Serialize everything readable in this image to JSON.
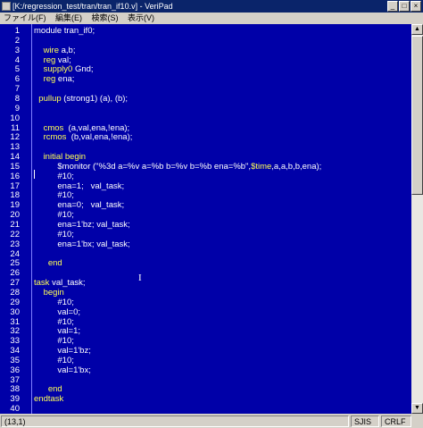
{
  "window": {
    "title": "[K:/regression_test/tran/tran_if10.v] - VeriPad",
    "buttons": {
      "minimize": "_",
      "maximize": "□",
      "close": "×"
    }
  },
  "menu": [
    "ファイル(F)",
    "編集(E)",
    "検索(S)",
    "表示(V)"
  ],
  "editor": {
    "line_numbers": [
      "1",
      "2",
      "3",
      "4",
      "5",
      "6",
      "7",
      "8",
      "9",
      "10",
      "11",
      "12",
      "13",
      "14",
      "15",
      "16",
      "17",
      "18",
      "19",
      "20",
      "21",
      "22",
      "23",
      "24",
      "25",
      "26",
      "27",
      "28",
      "29",
      "30",
      "31",
      "32",
      "33",
      "34",
      "35",
      "36",
      "37",
      "38",
      "39",
      "40"
    ],
    "lines": [
      [
        {
          "t": "module tran_if0;",
          "c": ""
        }
      ],
      [
        {
          "t": "",
          "c": ""
        }
      ],
      [
        {
          "t": "    ",
          "c": ""
        },
        {
          "t": "wire",
          "c": "kw"
        },
        {
          "t": " a,b;",
          "c": ""
        }
      ],
      [
        {
          "t": "    ",
          "c": ""
        },
        {
          "t": "reg",
          "c": "kw"
        },
        {
          "t": " val;",
          "c": ""
        }
      ],
      [
        {
          "t": "    ",
          "c": ""
        },
        {
          "t": "supply0",
          "c": "kw"
        },
        {
          "t": " Gnd;",
          "c": ""
        }
      ],
      [
        {
          "t": "    ",
          "c": ""
        },
        {
          "t": "reg",
          "c": "kw"
        },
        {
          "t": " ena;",
          "c": ""
        }
      ],
      [
        {
          "t": "",
          "c": ""
        }
      ],
      [
        {
          "t": "  ",
          "c": ""
        },
        {
          "t": "pullup",
          "c": "kw"
        },
        {
          "t": " (strong1) (a), (b);",
          "c": ""
        }
      ],
      [
        {
          "t": "",
          "c": ""
        }
      ],
      [
        {
          "t": "",
          "c": ""
        }
      ],
      [
        {
          "t": "    ",
          "c": ""
        },
        {
          "t": "cmos",
          "c": "kw"
        },
        {
          "t": "  (a,val,ena,!ena);",
          "c": ""
        }
      ],
      [
        {
          "t": "    ",
          "c": ""
        },
        {
          "t": "rcmos",
          "c": "kw"
        },
        {
          "t": "  (b,val,ena,!ena);",
          "c": ""
        }
      ],
      [
        {
          "t": "",
          "c": ""
        }
      ],
      [
        {
          "t": "    ",
          "c": ""
        },
        {
          "t": "initial begin",
          "c": "kw"
        }
      ],
      [
        {
          "t": "          $monitor (\"%3d a=%v a=%b b=%v b=%b ena=%b\",",
          "c": ""
        },
        {
          "t": "$time",
          "c": "sys"
        },
        {
          "t": ",a,a,b,b,ena);",
          "c": ""
        }
      ],
      [
        {
          "t": "          #10;",
          "c": ""
        }
      ],
      [
        {
          "t": "          ena=1;   val_task;",
          "c": ""
        }
      ],
      [
        {
          "t": "          #10;",
          "c": ""
        }
      ],
      [
        {
          "t": "          ena=0;   val_task;",
          "c": ""
        }
      ],
      [
        {
          "t": "          #10;",
          "c": ""
        }
      ],
      [
        {
          "t": "          ena=1'bz; val_task;",
          "c": ""
        }
      ],
      [
        {
          "t": "          #10;",
          "c": ""
        }
      ],
      [
        {
          "t": "          ena=1'bx; val_task;",
          "c": ""
        }
      ],
      [
        {
          "t": "",
          "c": ""
        }
      ],
      [
        {
          "t": "      ",
          "c": ""
        },
        {
          "t": "end",
          "c": "kw"
        }
      ],
      [
        {
          "t": "",
          "c": ""
        }
      ],
      [
        {
          "t": "task",
          "c": "kw"
        },
        {
          "t": " val_task;",
          "c": ""
        }
      ],
      [
        {
          "t": "    ",
          "c": ""
        },
        {
          "t": "begin",
          "c": "kw"
        }
      ],
      [
        {
          "t": "          #10;",
          "c": ""
        }
      ],
      [
        {
          "t": "          val=0;",
          "c": ""
        }
      ],
      [
        {
          "t": "          #10;",
          "c": ""
        }
      ],
      [
        {
          "t": "          val=1;",
          "c": ""
        }
      ],
      [
        {
          "t": "          #10;",
          "c": ""
        }
      ],
      [
        {
          "t": "          val=1'bz;",
          "c": ""
        }
      ],
      [
        {
          "t": "          #10;",
          "c": ""
        }
      ],
      [
        {
          "t": "          val=1'bx;",
          "c": ""
        }
      ],
      [
        {
          "t": "",
          "c": ""
        }
      ],
      [
        {
          "t": "      ",
          "c": ""
        },
        {
          "t": "end",
          "c": "kw"
        }
      ],
      [
        {
          "t": "endtask",
          "c": "kw"
        }
      ],
      [
        {
          "t": "",
          "c": ""
        }
      ]
    ]
  },
  "status": {
    "position": "(13,1)",
    "encoding": "SJIS",
    "line_ending": "CRLF"
  },
  "colors": {
    "editor_background": "#0000a8",
    "keyword": "#ffff55",
    "text": "#ffffff",
    "titlebar": "#0a246a"
  }
}
